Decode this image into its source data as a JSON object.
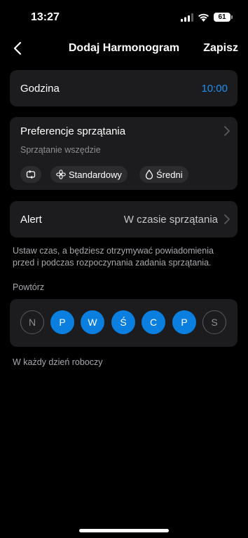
{
  "status": {
    "time": "13:27",
    "battery": "61"
  },
  "nav": {
    "title": "Dodaj Harmonogram",
    "save": "Zapisz"
  },
  "time_row": {
    "label": "Godzina",
    "value": "10:00",
    "value_color": "#1e8ff0"
  },
  "preferences": {
    "title": "Preferencje sprzątania",
    "subtitle": "Sprzątanie wszędzie",
    "chips": {
      "mode_icon": "repeat-icon",
      "suction": "Standardowy",
      "suction_icon": "fan-icon",
      "water": "Średni",
      "water_icon": "water-drop-icon"
    }
  },
  "alert": {
    "label": "Alert",
    "value": "W czasie sprzątania"
  },
  "hint": "Ustaw czas, a będziesz otrzymywać powiadomienia przed i podczas rozpoczynania zadania sprzątania.",
  "repeat": {
    "label": "Powtórz",
    "days": [
      {
        "letter": "N",
        "selected": false
      },
      {
        "letter": "P",
        "selected": true
      },
      {
        "letter": "W",
        "selected": true
      },
      {
        "letter": "Ś",
        "selected": true
      },
      {
        "letter": "C",
        "selected": true
      },
      {
        "letter": "P",
        "selected": true
      },
      {
        "letter": "S",
        "selected": false
      }
    ],
    "summary": "W każdy dzień roboczy",
    "accent": "#0a7fe0"
  }
}
